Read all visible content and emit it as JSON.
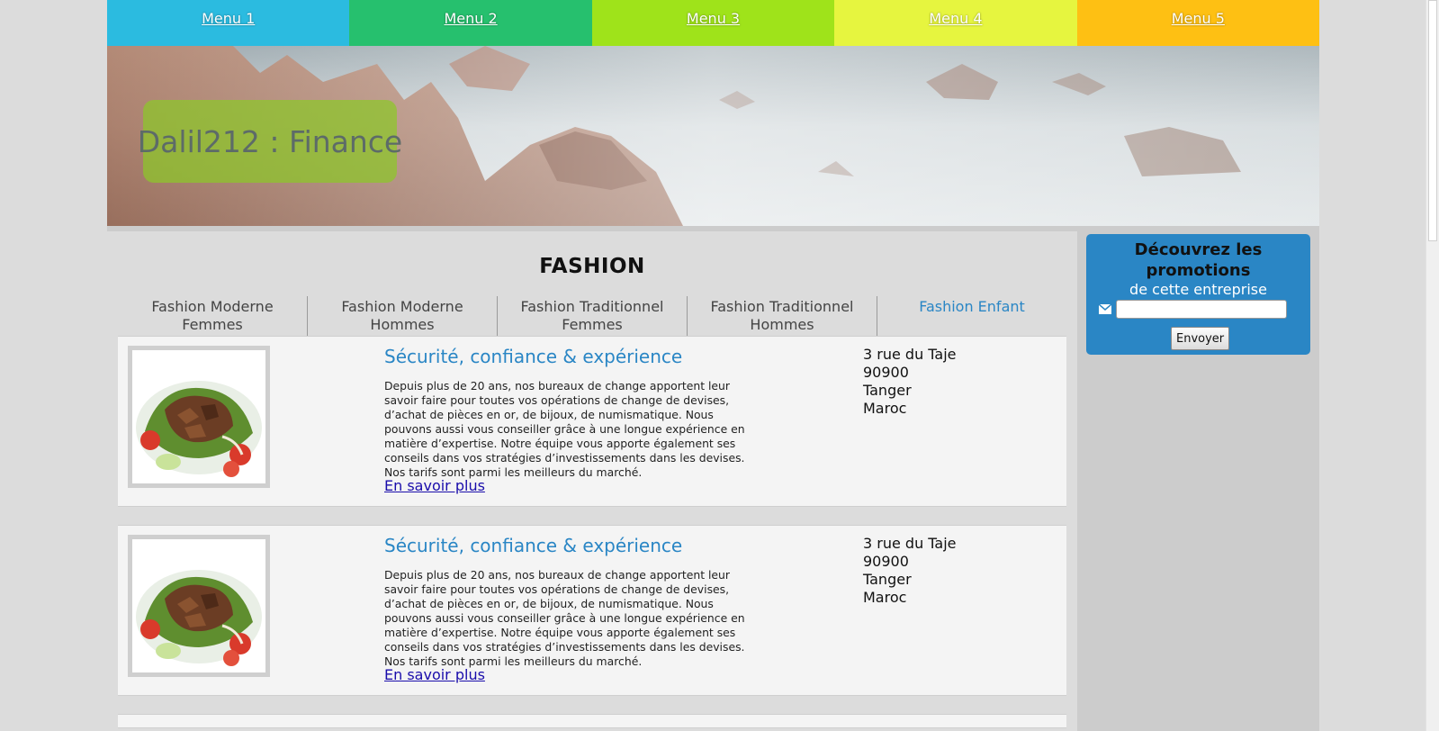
{
  "menu": [
    {
      "label": "Menu 1",
      "color": "#2bbbe0"
    },
    {
      "label": "Menu 2",
      "color": "#26c06e"
    },
    {
      "label": "Menu 3",
      "color": "#9fe31a"
    },
    {
      "label": "Menu 4",
      "color": "#e6f53f"
    },
    {
      "label": "Menu 5",
      "color": "#fec013"
    }
  ],
  "header": {
    "site_title": "Dalil212 : Finance"
  },
  "main": {
    "section_title": "FASHION",
    "categories": [
      {
        "line1": "Fashion Moderne",
        "line2": "Femmes"
      },
      {
        "line1": "Fashion Moderne",
        "line2": "Hommes"
      },
      {
        "line1": "Fashion Traditionnel",
        "line2": "Femmes"
      },
      {
        "line1": "Fashion Traditionnel",
        "line2": "Hommes"
      },
      {
        "line1": "Fashion Enfant",
        "line2": ""
      }
    ],
    "cards": [
      {
        "title": "Sécurité, confiance & expérience",
        "text": "Depuis plus de 20 ans, nos bureaux de change apportent leur savoir faire pour toutes vos opérations de change de devises, d’achat de pièces en or, de bijoux, de numismatique. Nous pouvons aussi vous conseiller grâce à une longue expérience en matière d’expertise. Notre équipe vous apporte également ses conseils dans vos stratégies d’investissements dans les devises. Nos tarifs sont parmi les meilleurs du marché.",
        "link": "En savoir plus",
        "address": [
          "3 rue du Taje",
          "90900",
          "Tanger",
          "Maroc"
        ]
      },
      {
        "title": "Sécurité, confiance & expérience",
        "text": "Depuis plus de 20 ans, nos bureaux de change apportent leur savoir faire pour toutes vos opérations de change de devises, d’achat de pièces en or, de bijoux, de numismatique. Nous pouvons aussi vous conseiller grâce à une longue expérience en matière d’expertise. Notre équipe vous apporte également ses conseils dans vos stratégies d’investissements dans les devises. Nos tarifs sont parmi les meilleurs du marché.",
        "link": "En savoir plus",
        "address": [
          "3 rue du Taje",
          "90900",
          "Tanger",
          "Maroc"
        ]
      }
    ]
  },
  "sidebar": {
    "promo_title_1": "Découvrez les",
    "promo_title_2": "promotions",
    "promo_sub": "de cette entreprise",
    "email_value": "",
    "submit_label": "Envoyer",
    "icon": "envelope-icon"
  },
  "colors": {
    "accent": "#2a86c5",
    "title_box": "#8cc828"
  }
}
